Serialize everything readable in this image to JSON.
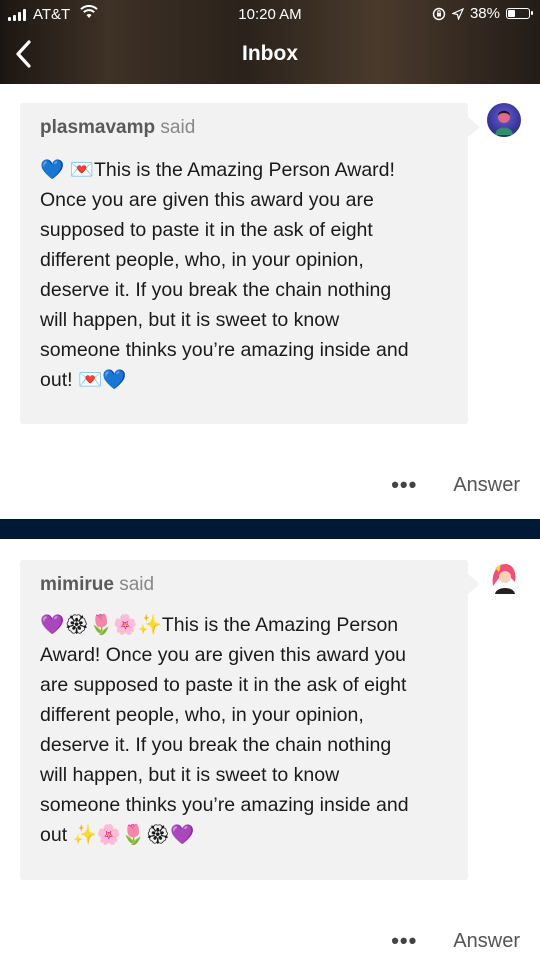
{
  "status_bar": {
    "carrier": "AT&T",
    "time": "10:20 AM",
    "battery": "38%"
  },
  "header": {
    "title": "Inbox"
  },
  "messages": [
    {
      "sender": "plasmavamp",
      "said": "said",
      "text": "💙 💌This is the Amazing Person Award!\nOnce you are given this award you are\nsupposed to paste it in the ask of eight\ndifferent people, who, in your opinion,\ndeserve it. If you break the chain nothing\nwill happen, but it is sweet to know\nsomeone thinks you’re amazing inside and\nout! 💌💙",
      "more": "•••",
      "answer": "Answer"
    },
    {
      "sender": "mimirue",
      "said": "said",
      "text": "💜🏵🌷🌸✨This is the Amazing Person\nAward! Once you are given this award you\nare supposed to paste it in the ask of eight\ndifferent people, who, in your opinion,\ndeserve it. If you break the chain nothing\nwill happen, but it is sweet to know\nsomeone thinks you’re amazing inside and\nout ✨🌸🌷🏵💜",
      "more": "•••",
      "answer": "Answer"
    }
  ],
  "colors": {
    "divider": "#001935",
    "card": "#f2f2f2"
  }
}
